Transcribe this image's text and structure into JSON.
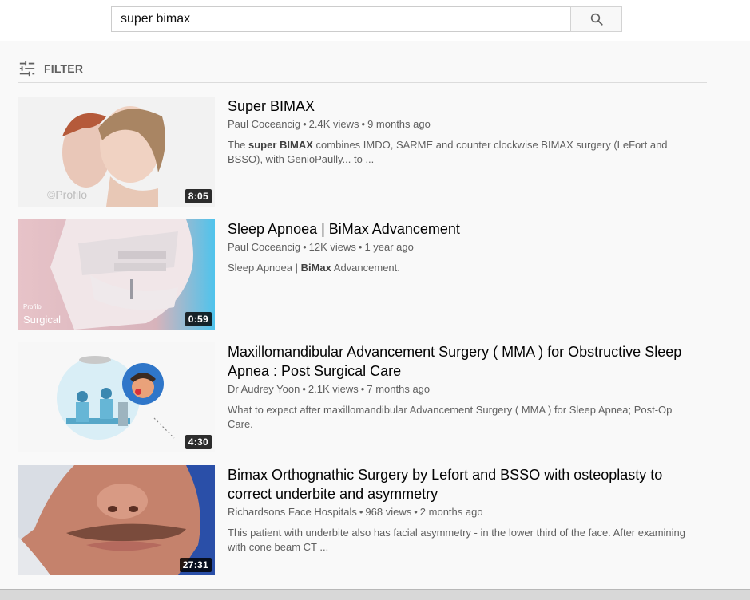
{
  "search": {
    "query": "super bimax"
  },
  "filter": {
    "label": "FILTER"
  },
  "results": [
    {
      "title": "Super BIMAX",
      "channel": "Paul Coceancig",
      "views": "2.4K views",
      "age": "9 months ago",
      "duration": "8:05",
      "watermark": "©Profilo",
      "desc_parts": [
        {
          "text": "The ",
          "bold": false
        },
        {
          "text": "super BIMAX",
          "bold": true
        },
        {
          "text": " combines IMDO, SARME and counter clockwise BIMAX surgery (LeFort and BSSO), with GenioPaully... to ...",
          "bold": false
        }
      ]
    },
    {
      "title": "Sleep Apnoea | BiMax Advancement",
      "channel": "Paul Coceancig",
      "views": "12K views",
      "age": "1 year ago",
      "duration": "0:59",
      "watermark_top": "Profilo'",
      "watermark_bottom": "Surgical",
      "desc_parts": [
        {
          "text": "Sleep Apnoea | ",
          "bold": false
        },
        {
          "text": "BiMax",
          "bold": true
        },
        {
          "text": " Advancement.",
          "bold": false
        }
      ]
    },
    {
      "title": "Maxillomandibular Advancement Surgery ( MMA ) for Obstructive Sleep Apnea : Post Surgical Care",
      "channel": "Dr Audrey Yoon",
      "views": "2.1K views",
      "age": "7 months ago",
      "duration": "4:30",
      "desc_parts": [
        {
          "text": "What to expect after maxillomandibular Advancement Surgery ( MMA ) for Sleep Apnea; Post-Op Care.",
          "bold": false
        }
      ]
    },
    {
      "title": "Bimax Orthognathic Surgery by Lefort and BSSO with osteoplasty to correct underbite and asymmetry",
      "channel": "Richardsons Face Hospitals",
      "views": "968 views",
      "age": "2 months ago",
      "duration": "27:31",
      "desc_parts": [
        {
          "text": "This patient with underbite also has facial asymmetry - in the lower third of the face. After examining with cone beam CT ...",
          "bold": false
        }
      ]
    }
  ],
  "meta_separator": "•",
  "icons": {
    "search": "search-icon",
    "filter": "filter-sliders-icon"
  },
  "colors": {
    "background": "#f9f9f9",
    "meta_text": "#606060",
    "duration_bg": "#000000"
  }
}
